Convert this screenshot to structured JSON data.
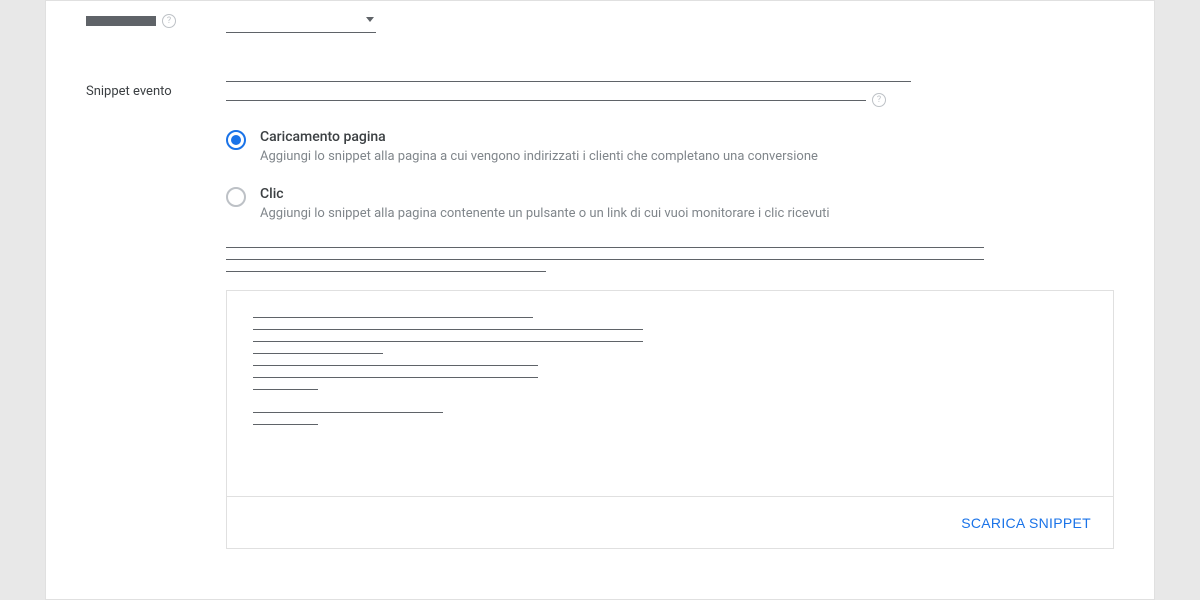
{
  "section": {
    "snippet_label": "Snippet evento"
  },
  "radios": {
    "page_load": {
      "title": "Caricamento pagina",
      "desc": "Aggiungi lo snippet alla pagina a cui vengono indirizzati i clienti che completano una conversione"
    },
    "click": {
      "title": "Clic",
      "desc": "Aggiungi lo snippet alla pagina contenente un pulsante o un link di cui vuoi monitorare i clic ricevuti"
    }
  },
  "buttons": {
    "download": "SCARICA SNIPPET"
  }
}
